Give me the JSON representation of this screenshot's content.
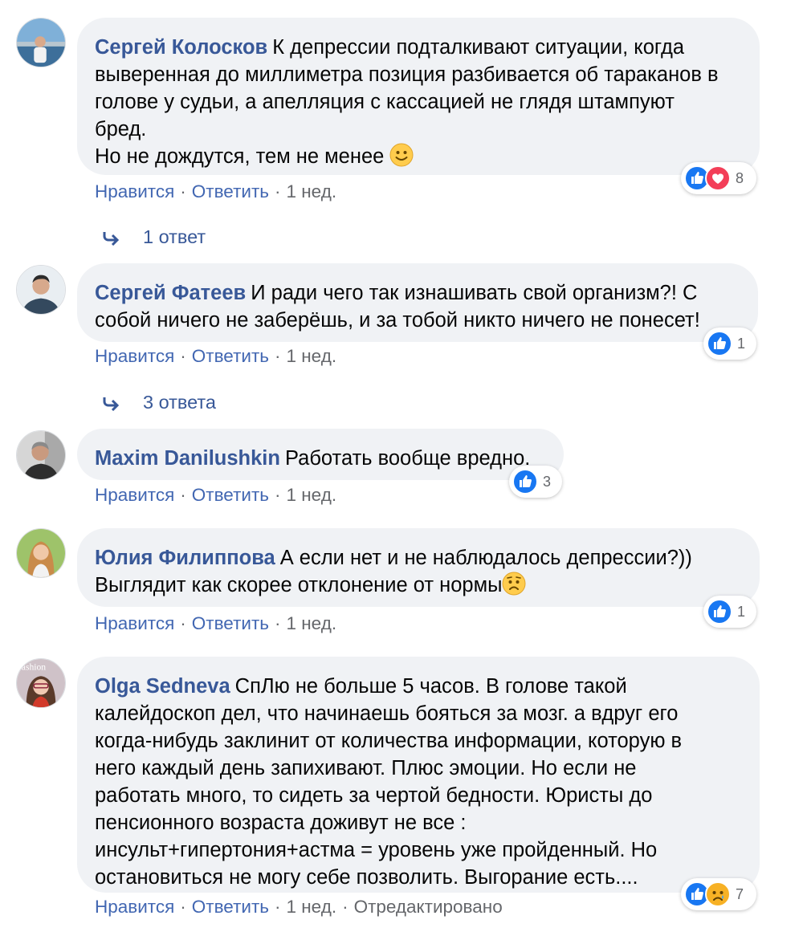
{
  "labels": {
    "like": "Нравится",
    "reply": "Ответить",
    "sep": "·"
  },
  "colors": {
    "link": "#4267b2",
    "author": "#385898",
    "bubble": "#f0f2f5",
    "meta": "#65676b"
  },
  "comments": [
    {
      "author": "Сергей Колосков",
      "text": "К депрессии подталкивают ситуации, когда\nвыверенная до миллиметра позиция разбивается об тараканов в\nголове у судьи, а апелляция с кассацией не глядя штампуют\nбред.\nНо не дождутся, тем не менее ",
      "emoji": "slightly-smiling-face",
      "time": "1 нед.",
      "reactions": {
        "icons": [
          "like-icon",
          "love-icon"
        ],
        "count": "8"
      },
      "replies": "1 ответ"
    },
    {
      "author": "Сергей Фатеев",
      "text": "И ради чего так изнашивать свой организм?! С\nсобой ничего не заберёшь, и за тобой никто ничего не понесет!",
      "time": "1 нед.",
      "reactions": {
        "icons": [
          "like-icon"
        ],
        "count": "1"
      },
      "replies": "3 ответа"
    },
    {
      "author": "Maxim Danilushkin",
      "text": "Работать вообще вредно.",
      "time": "1 нед.",
      "reactions": {
        "icons": [
          "like-icon"
        ],
        "count": "3"
      }
    },
    {
      "author": "Юлия Филиппова",
      "text": "А если нет и не наблюдалось депрессии?))\nВыглядит как скорее отклонение от нормы",
      "emoji": "worried-face",
      "time": "1 нед.",
      "reactions": {
        "icons": [
          "like-icon"
        ],
        "count": "1"
      }
    },
    {
      "author": "Olga Sedneva",
      "text": "СпЛю не больше 5 часов. В голове такой\nкалейдоскоп дел, что начинаешь бояться за мозг. а вдруг его\nкогда-нибудь заклинит от количества информации, которую в\nнего каждый день запихивают. Плюс эмоции. Но если не\nработать много, то сидеть за чертой бедности. Юристы до\nпенсионного возраста доживут не все :\nинсульт+гипертония+астма = уровень уже пройденный. Но\nостановиться не могу себе позволить. Выгорание есть....",
      "time": "1 нед.",
      "edited": "Отредактировано",
      "reactions": {
        "icons": [
          "like-icon",
          "sad-icon"
        ],
        "count": "7"
      },
      "avatar_text": "ashion"
    }
  ]
}
